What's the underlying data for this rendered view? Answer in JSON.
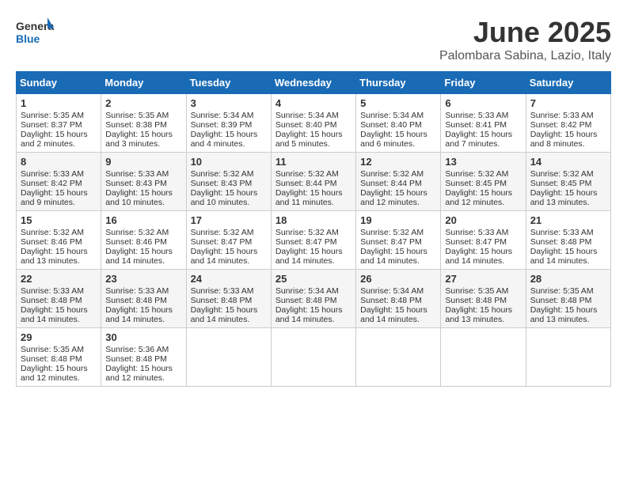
{
  "header": {
    "logo_general": "General",
    "logo_blue": "Blue",
    "title": "June 2025",
    "subtitle": "Palombara Sabina, Lazio, Italy"
  },
  "calendar": {
    "days_of_week": [
      "Sunday",
      "Monday",
      "Tuesday",
      "Wednesday",
      "Thursday",
      "Friday",
      "Saturday"
    ],
    "weeks": [
      [
        {
          "day": "",
          "content": ""
        },
        {
          "day": "",
          "content": ""
        },
        {
          "day": "",
          "content": ""
        },
        {
          "day": "",
          "content": ""
        },
        {
          "day": "",
          "content": ""
        },
        {
          "day": "",
          "content": ""
        },
        {
          "day": "",
          "content": ""
        }
      ]
    ],
    "cells": [
      {
        "day": "1",
        "sunrise": "5:35 AM",
        "sunset": "8:37 PM",
        "daylight": "15 hours and 2 minutes."
      },
      {
        "day": "2",
        "sunrise": "5:35 AM",
        "sunset": "8:38 PM",
        "daylight": "15 hours and 3 minutes."
      },
      {
        "day": "3",
        "sunrise": "5:34 AM",
        "sunset": "8:39 PM",
        "daylight": "15 hours and 4 minutes."
      },
      {
        "day": "4",
        "sunrise": "5:34 AM",
        "sunset": "8:40 PM",
        "daylight": "15 hours and 5 minutes."
      },
      {
        "day": "5",
        "sunrise": "5:34 AM",
        "sunset": "8:40 PM",
        "daylight": "15 hours and 6 minutes."
      },
      {
        "day": "6",
        "sunrise": "5:33 AM",
        "sunset": "8:41 PM",
        "daylight": "15 hours and 7 minutes."
      },
      {
        "day": "7",
        "sunrise": "5:33 AM",
        "sunset": "8:42 PM",
        "daylight": "15 hours and 8 minutes."
      },
      {
        "day": "8",
        "sunrise": "5:33 AM",
        "sunset": "8:42 PM",
        "daylight": "15 hours and 9 minutes."
      },
      {
        "day": "9",
        "sunrise": "5:33 AM",
        "sunset": "8:43 PM",
        "daylight": "15 hours and 10 minutes."
      },
      {
        "day": "10",
        "sunrise": "5:32 AM",
        "sunset": "8:43 PM",
        "daylight": "15 hours and 10 minutes."
      },
      {
        "day": "11",
        "sunrise": "5:32 AM",
        "sunset": "8:44 PM",
        "daylight": "15 hours and 11 minutes."
      },
      {
        "day": "12",
        "sunrise": "5:32 AM",
        "sunset": "8:44 PM",
        "daylight": "15 hours and 12 minutes."
      },
      {
        "day": "13",
        "sunrise": "5:32 AM",
        "sunset": "8:45 PM",
        "daylight": "15 hours and 12 minutes."
      },
      {
        "day": "14",
        "sunrise": "5:32 AM",
        "sunset": "8:45 PM",
        "daylight": "15 hours and 13 minutes."
      },
      {
        "day": "15",
        "sunrise": "5:32 AM",
        "sunset": "8:46 PM",
        "daylight": "15 hours and 13 minutes."
      },
      {
        "day": "16",
        "sunrise": "5:32 AM",
        "sunset": "8:46 PM",
        "daylight": "15 hours and 14 minutes."
      },
      {
        "day": "17",
        "sunrise": "5:32 AM",
        "sunset": "8:47 PM",
        "daylight": "15 hours and 14 minutes."
      },
      {
        "day": "18",
        "sunrise": "5:32 AM",
        "sunset": "8:47 PM",
        "daylight": "15 hours and 14 minutes."
      },
      {
        "day": "19",
        "sunrise": "5:32 AM",
        "sunset": "8:47 PM",
        "daylight": "15 hours and 14 minutes."
      },
      {
        "day": "20",
        "sunrise": "5:33 AM",
        "sunset": "8:47 PM",
        "daylight": "15 hours and 14 minutes."
      },
      {
        "day": "21",
        "sunrise": "5:33 AM",
        "sunset": "8:48 PM",
        "daylight": "15 hours and 14 minutes."
      },
      {
        "day": "22",
        "sunrise": "5:33 AM",
        "sunset": "8:48 PM",
        "daylight": "15 hours and 14 minutes."
      },
      {
        "day": "23",
        "sunrise": "5:33 AM",
        "sunset": "8:48 PM",
        "daylight": "15 hours and 14 minutes."
      },
      {
        "day": "24",
        "sunrise": "5:33 AM",
        "sunset": "8:48 PM",
        "daylight": "15 hours and 14 minutes."
      },
      {
        "day": "25",
        "sunrise": "5:34 AM",
        "sunset": "8:48 PM",
        "daylight": "15 hours and 14 minutes."
      },
      {
        "day": "26",
        "sunrise": "5:34 AM",
        "sunset": "8:48 PM",
        "daylight": "15 hours and 14 minutes."
      },
      {
        "day": "27",
        "sunrise": "5:35 AM",
        "sunset": "8:48 PM",
        "daylight": "15 hours and 13 minutes."
      },
      {
        "day": "28",
        "sunrise": "5:35 AM",
        "sunset": "8:48 PM",
        "daylight": "15 hours and 13 minutes."
      },
      {
        "day": "29",
        "sunrise": "5:35 AM",
        "sunset": "8:48 PM",
        "daylight": "15 hours and 12 minutes."
      },
      {
        "day": "30",
        "sunrise": "5:36 AM",
        "sunset": "8:48 PM",
        "daylight": "15 hours and 12 minutes."
      }
    ]
  }
}
